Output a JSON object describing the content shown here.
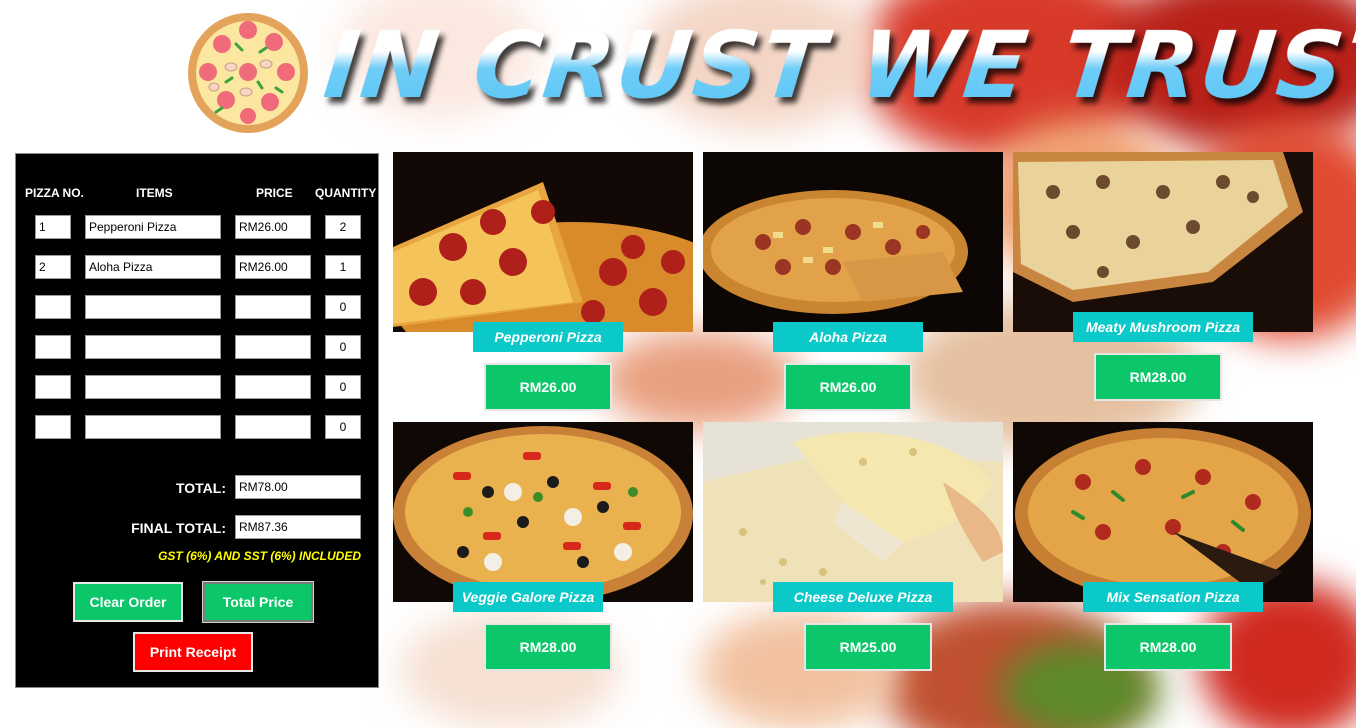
{
  "app": {
    "title": "IN CRUST WE TRUST"
  },
  "order_table": {
    "headers": [
      "PIZZA NO.",
      "ITEMS",
      "PRICE",
      "QUANTITY"
    ],
    "rows": [
      {
        "no": "1",
        "item": "Pepperoni Pizza",
        "price": "RM26.00",
        "qty": "2"
      },
      {
        "no": "2",
        "item": "Aloha Pizza",
        "price": "RM26.00",
        "qty": "1"
      },
      {
        "no": "",
        "item": "",
        "price": "",
        "qty": "0"
      },
      {
        "no": "",
        "item": "",
        "price": "",
        "qty": "0"
      },
      {
        "no": "",
        "item": "",
        "price": "",
        "qty": "0"
      },
      {
        "no": "",
        "item": "",
        "price": "",
        "qty": "0"
      }
    ],
    "total_label": "TOTAL:",
    "total_value": "RM78.00",
    "final_total_label": "FINAL TOTAL:",
    "final_total_value": "RM87.36",
    "tax_note": "GST (6%) AND SST (6%) INCLUDED"
  },
  "buttons": {
    "clear_order": "Clear Order",
    "total_price": "Total Price",
    "print_receipt": "Print Receipt"
  },
  "menu": [
    {
      "name": "Pepperoni Pizza",
      "price": "RM26.00",
      "icon": "pepperoni-pizza-image"
    },
    {
      "name": "Aloha Pizza",
      "price": "RM26.00",
      "icon": "aloha-pizza-image"
    },
    {
      "name": "Meaty Mushroom Pizza",
      "price": "RM28.00",
      "icon": "meaty-mushroom-pizza-image"
    },
    {
      "name": "Veggie Galore Pizza",
      "price": "RM28.00",
      "icon": "veggie-galore-pizza-image"
    },
    {
      "name": "Cheese Deluxe Pizza",
      "price": "RM25.00",
      "icon": "cheese-deluxe-pizza-image"
    },
    {
      "name": "Mix Sensation Pizza",
      "price": "RM28.00",
      "icon": "mix-sensation-pizza-image"
    }
  ],
  "colors": {
    "panel_bg": "#000000",
    "button_green": "#0cc76a",
    "button_red": "#ff0000",
    "name_tag": "#0bc9c9",
    "title_blue": "#6fd0ff",
    "tax_note": "#ffff00"
  }
}
